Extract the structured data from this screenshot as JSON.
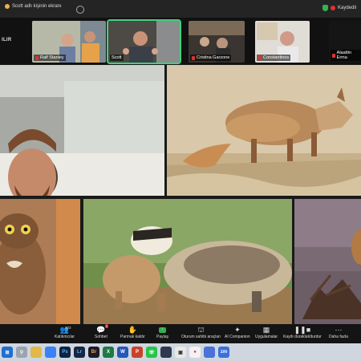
{
  "titlebar": {
    "title": "Scott adlı kişinin ekranı",
    "recording": "Kaydedil"
  },
  "strip": {
    "left_label": "ILIR",
    "participants": [
      {
        "name": "Ralf Stanley"
      },
      {
        "name": "Scott"
      },
      {
        "name": "Cristina Garzone"
      },
      {
        "name": "Constantinos"
      },
      {
        "name": "Alaattin Erma"
      }
    ]
  },
  "toolbar": {
    "participants_count": "303",
    "chat_badge": "1",
    "items": [
      {
        "label": "Katılımcılar"
      },
      {
        "label": "Sohbet"
      },
      {
        "label": "Parmak kaldır"
      },
      {
        "label": "Paylaş"
      },
      {
        "label": "Oturum sahibi araçları"
      },
      {
        "label": "AI Companion"
      },
      {
        "label": "Uygulamalar"
      },
      {
        "label": "Kaydı duraklat/durdur"
      },
      {
        "label": "Daha fazla"
      }
    ]
  },
  "taskbar": {
    "apps": [
      {
        "icon": "start-icon"
      },
      {
        "icon": "search-icon"
      },
      {
        "icon": "task-view-icon"
      },
      {
        "icon": "file-explorer-icon"
      },
      {
        "icon": "photoshop-icon"
      },
      {
        "icon": "lightroom-icon"
      },
      {
        "icon": "bridge-icon"
      },
      {
        "icon": "excel-icon"
      },
      {
        "icon": "word-icon"
      },
      {
        "icon": "powerpoint-icon"
      },
      {
        "icon": "whatsapp-icon"
      },
      {
        "icon": "app-icon"
      },
      {
        "icon": "chrome-icon"
      },
      {
        "icon": "zoom-icon"
      }
    ]
  },
  "colors": {
    "active_speaker": "#3fd27b",
    "toolbar_bg": "#141414",
    "taskbar_bg": "#cfd6e0"
  }
}
